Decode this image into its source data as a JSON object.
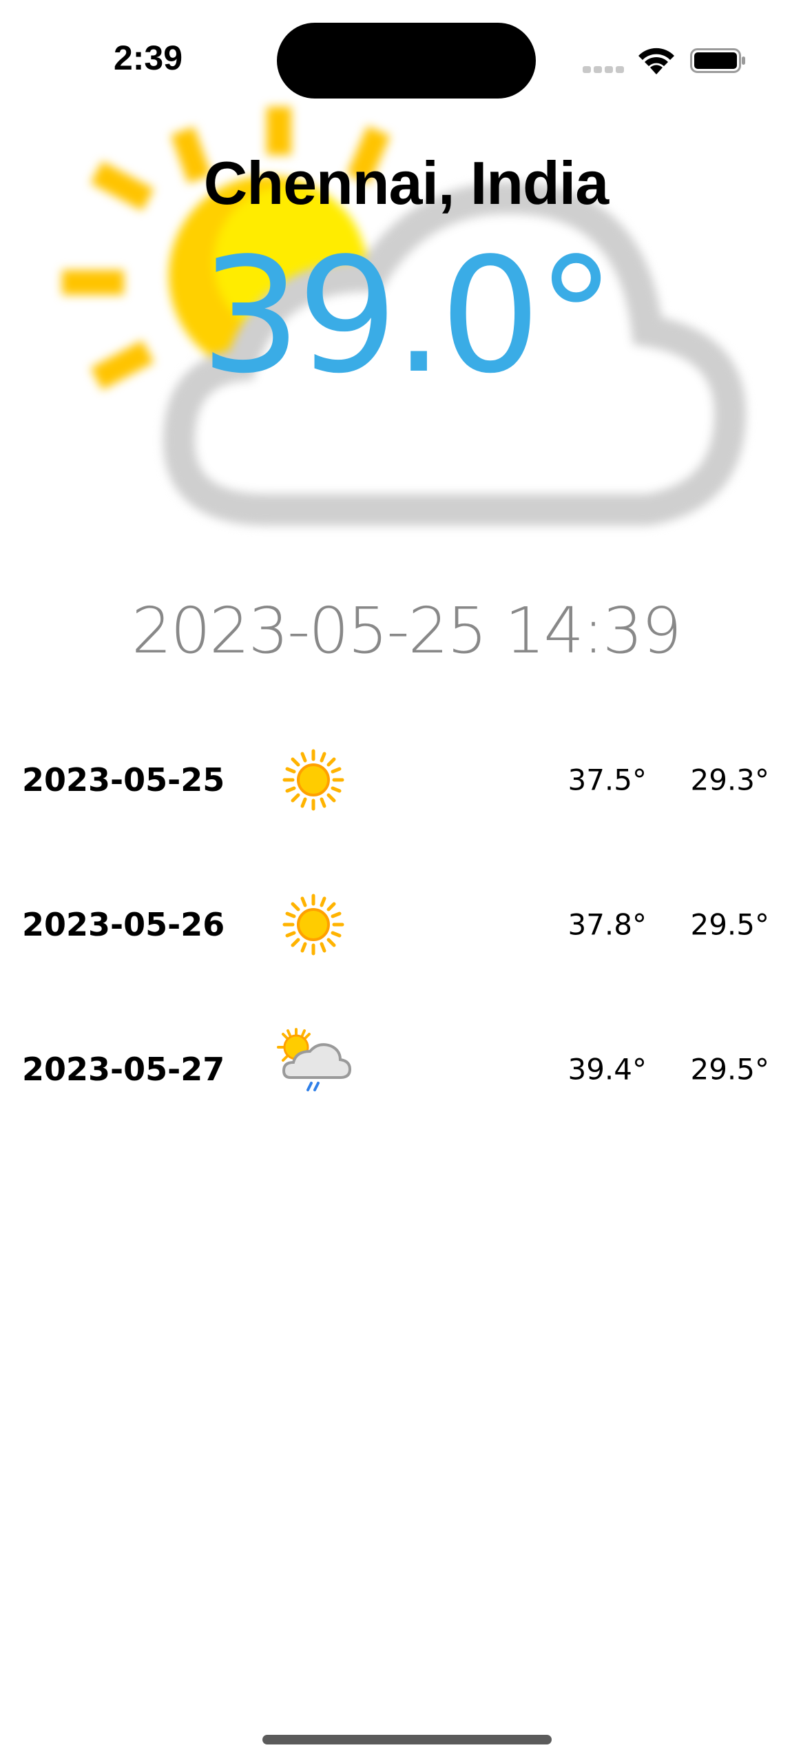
{
  "status_bar": {
    "time": "2:39",
    "icons": [
      "cellular-signal-icon",
      "wifi-icon",
      "battery-icon"
    ]
  },
  "current": {
    "city": "Chennai, India",
    "temperature": "39.0°",
    "timestamp": "2023-05-25 14:39",
    "condition_icon": "sun-behind-cloud-icon"
  },
  "forecast": [
    {
      "date": "2023-05-25",
      "icon": "sunny-icon",
      "high": "37.5°",
      "low": "29.3°"
    },
    {
      "date": "2023-05-26",
      "icon": "sunny-icon",
      "high": "37.8°",
      "low": "29.5°"
    },
    {
      "date": "2023-05-27",
      "icon": "sun-cloud-rain-icon",
      "high": "39.4°",
      "low": "29.5°"
    }
  ],
  "colors": {
    "temperature": "#3aace6",
    "timestamp": "#888888",
    "sun": "#ffc400",
    "cloud": "#cfcfcf"
  }
}
